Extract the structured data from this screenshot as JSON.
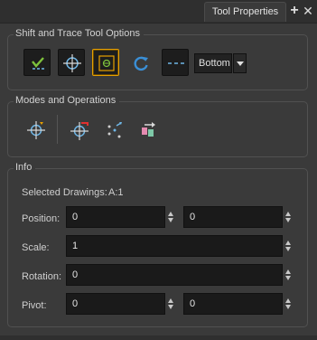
{
  "panel": {
    "tab_title": "Tool Properties",
    "add_icon": "plus-icon",
    "close_icon": "close-icon"
  },
  "shift_trace": {
    "title": "Shift and Trace Tool Options",
    "tools": [
      {
        "name": "check-onion-icon",
        "state": "normal"
      },
      {
        "name": "crosshair-icon",
        "state": "normal"
      },
      {
        "name": "pivot-box-icon",
        "state": "selected"
      },
      {
        "name": "rotate-icon",
        "state": "plain"
      },
      {
        "name": "dashed-line-icon",
        "state": "normal"
      }
    ],
    "position_select": "Bottom"
  },
  "modes": {
    "title": "Modes and Operations",
    "tools": [
      "target-icon",
      "reset-target-icon",
      "scatter-points-icon",
      "swap-drawings-icon"
    ]
  },
  "info": {
    "title": "Info",
    "selected_label": "Selected Drawings:",
    "selected_value": "A:1",
    "position_label": "Position:",
    "position_x": "0",
    "position_y": "0",
    "scale_label": "Scale:",
    "scale_value": "1",
    "rotation_label": "Rotation:",
    "rotation_value": "0",
    "pivot_label": "Pivot:",
    "pivot_x": "0",
    "pivot_y": "0"
  },
  "colors": {
    "accent_selected": "#e6a000",
    "icon_blue": "#6fb6e6",
    "check_green": "#7ec23c",
    "panel_bg": "#3a3a3a"
  }
}
